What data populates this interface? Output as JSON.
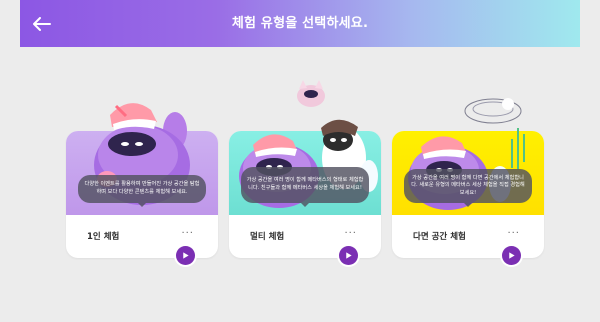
{
  "header": {
    "title": "체험 유형을 선택하세요.",
    "back_icon": "arrow-left-icon"
  },
  "colors": {
    "header_start": "#8c57e4",
    "header_end": "#9fe9ee",
    "card1_bg": "#c7a6ef",
    "card2_bg": "#7be7d7",
    "card3_bg": "#ffe600",
    "play_button": "#7b2fb3"
  },
  "cards": [
    {
      "label": "1인 체험",
      "bubble": "다양한 이벤트를 활용하여 만들어진 가상 공간을 탐험하며 보다 다양한 콘텐츠를 체험해 보세요.",
      "more": "···",
      "play_icon": "play-icon"
    },
    {
      "label": "멀티 체험",
      "bubble": "가상 공간을 여러 명이 함께 메타버스의 형태로 체험합니다. 친구들과 함께 메타버스 세상을 체험해 보세요!",
      "more": "···",
      "play_icon": "play-icon"
    },
    {
      "label": "다면 공간 체험",
      "bubble": "가상 공간을 여러 명이 함께 다면 공간에서 체험합니다. 새로운 유형의 메타버스 세상 체험을 직접 경험해 보세요!",
      "more": "···",
      "play_icon": "play-icon"
    }
  ]
}
